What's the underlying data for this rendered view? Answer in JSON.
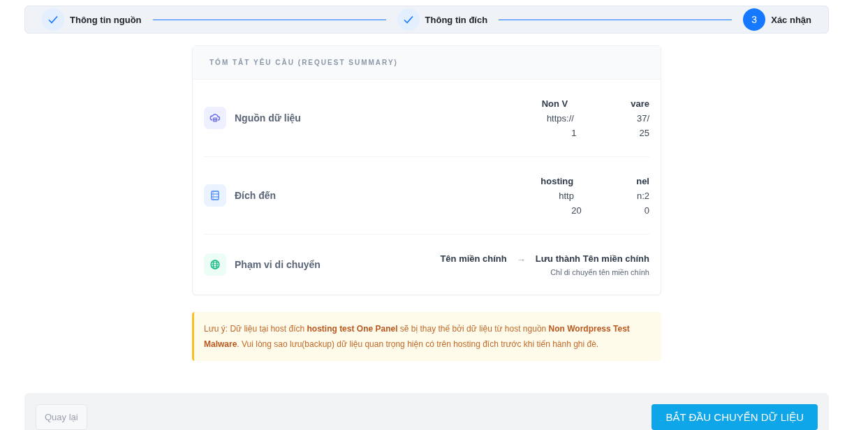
{
  "steps": [
    {
      "label": "Thông tin nguồn",
      "completed": true
    },
    {
      "label": "Thông tin đích",
      "completed": true
    },
    {
      "label": "Xác nhận",
      "number": "3",
      "completed": false
    }
  ],
  "summary": {
    "title": "TÓM TẮT YÊU CẦU (REQUEST SUMMARY)",
    "rows": [
      {
        "kind": "source",
        "label": "Nguồn dữ liệu",
        "lines": [
          {
            "bold": true,
            "parts": [
              "Non V",
              "vare"
            ]
          },
          {
            "bold": false,
            "parts": [
              "https://",
              "37/"
            ]
          },
          {
            "bold": false,
            "parts": [
              "1",
              "25"
            ]
          }
        ]
      },
      {
        "kind": "destination",
        "label": "Đích đến",
        "lines": [
          {
            "bold": true,
            "parts": [
              "hosting",
              "nel"
            ]
          },
          {
            "bold": false,
            "parts": [
              "http",
              "n:2"
            ]
          },
          {
            "bold": false,
            "parts": [
              "20",
              "0"
            ]
          }
        ]
      },
      {
        "kind": "scope",
        "label": "Phạm vi di chuyển",
        "from": "Tên miền chính",
        "arrow": "→",
        "to": "Lưu thành Tên miền chính",
        "note": "Chỉ di chuyển tên miền chính"
      }
    ]
  },
  "warning": "Lưu ý: Dữ liệu tại host đích **hosting test One Panel** sẽ bị thay thế bởi dữ liệu từ host nguồn **Non Wordpress Test Malware**. Vui lòng sao lưu(backup) dữ liệu quan trọng hiện có trên hosting đích trước khi tiến hành ghi đè.",
  "footer": {
    "back": "Quay lại",
    "start": "BẮT ĐẦU CHUYỂN DỮ LIỆU"
  }
}
